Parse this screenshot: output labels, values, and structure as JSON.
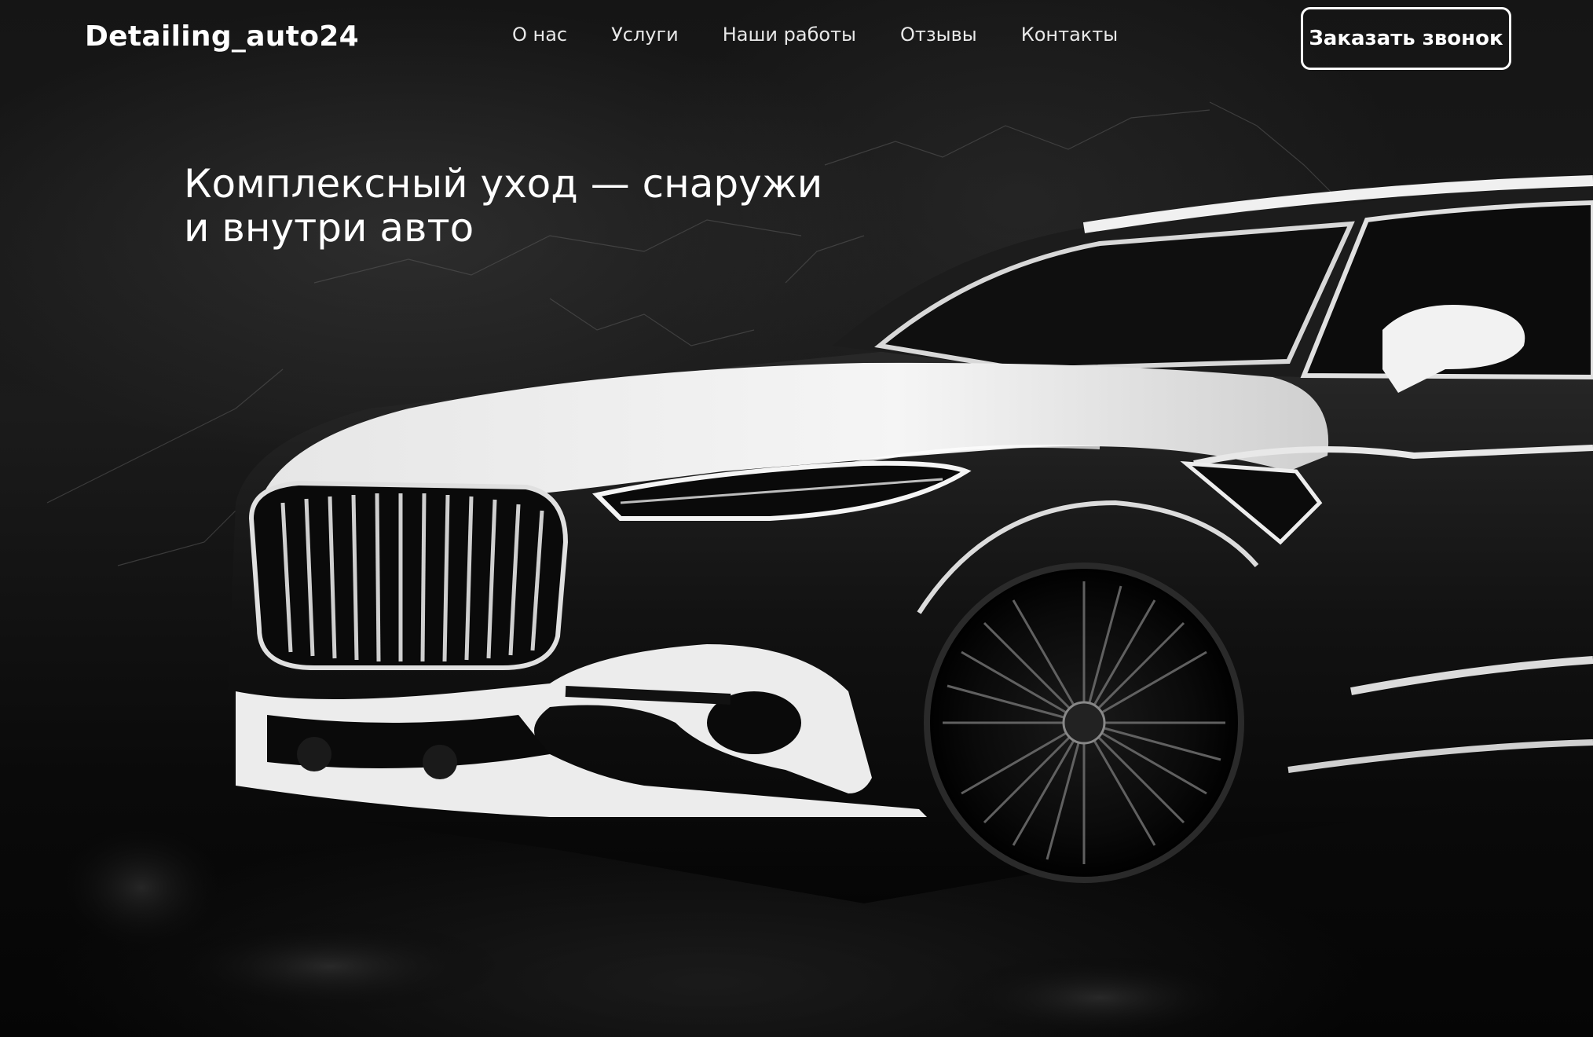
{
  "brand": {
    "logo_text": "Detailing_auto24"
  },
  "nav": {
    "items": [
      {
        "label": "О нас"
      },
      {
        "label": "Услуги"
      },
      {
        "label": "Наши работы"
      },
      {
        "label": "Отзывы"
      },
      {
        "label": "Контакты"
      }
    ]
  },
  "header": {
    "cta_label": "Заказать звонок"
  },
  "hero": {
    "headline_line1": "Комплексный уход — снаружи",
    "headline_line2": "и внутри авто",
    "image_subject": "black-and-white-suv-car"
  },
  "colors": {
    "background": "#0d0d0d",
    "text": "#ffffff",
    "nav_text": "#e8e8e8",
    "button_border": "#ffffff"
  }
}
